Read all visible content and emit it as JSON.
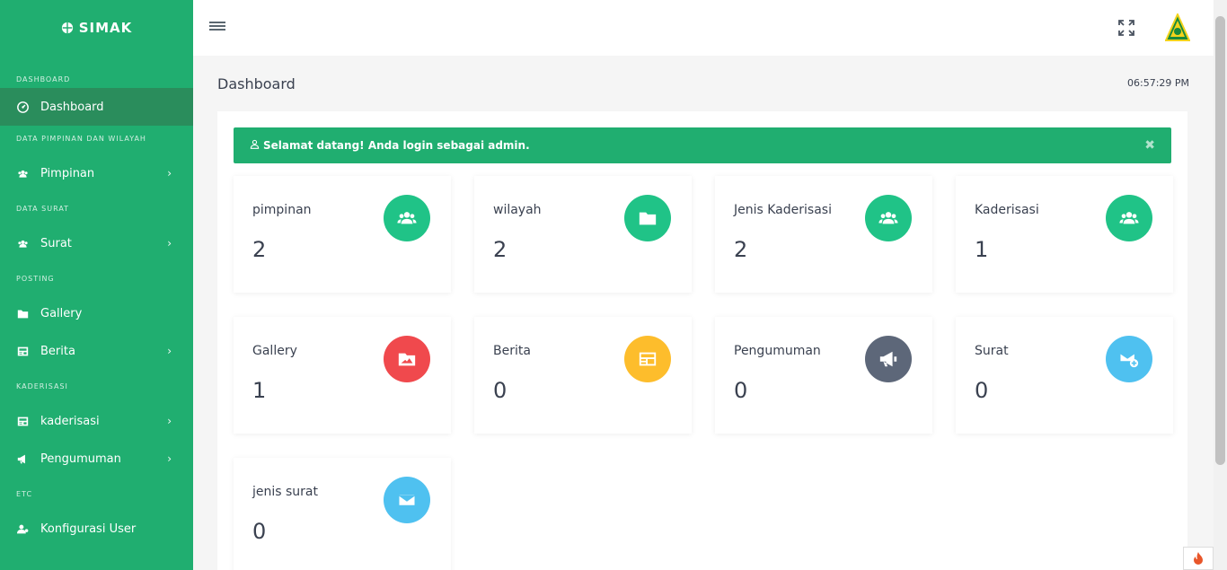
{
  "app": {
    "name": "SIMAK"
  },
  "sidebar": {
    "sections": [
      {
        "title": "DASHBOARD"
      },
      {
        "title": "DATA PIMPINAN DAN WILAYAH"
      },
      {
        "title": "DATA SURAT"
      },
      {
        "title": "POSTING"
      },
      {
        "title": "KADERISASI"
      },
      {
        "title": "ETC"
      }
    ],
    "items": [
      {
        "label": "Dashboard",
        "icon": "dashboard-icon"
      },
      {
        "label": "Pimpinan",
        "icon": "users-icon",
        "chevron": "›"
      },
      {
        "label": "Surat",
        "icon": "users-icon",
        "chevron": "›"
      },
      {
        "label": "Gallery",
        "icon": "folder-icon"
      },
      {
        "label": "Berita",
        "icon": "newspaper-icon",
        "chevron": "›"
      },
      {
        "label": "kaderisasi",
        "icon": "newspaper-icon",
        "chevron": "›"
      },
      {
        "label": "Pengumuman",
        "icon": "bullhorn-icon",
        "chevron": "›"
      },
      {
        "label": "Konfigurasi User",
        "icon": "users-cog-icon"
      }
    ]
  },
  "header": {
    "page_title": "Dashboard",
    "time": "06:57:29 PM"
  },
  "alert": {
    "message": "Selamat datang! Anda login sebagai admin.",
    "close": "✖"
  },
  "stats": [
    {
      "title": "pimpinan",
      "value": "2",
      "icon": "users-icon",
      "color": "#20c387"
    },
    {
      "title": "wilayah",
      "value": "2",
      "icon": "folder-icon",
      "color": "#20c387"
    },
    {
      "title": "Jenis Kaderisasi",
      "value": "2",
      "icon": "users-icon",
      "color": "#20c387"
    },
    {
      "title": "Kaderisasi",
      "value": "1",
      "icon": "users-icon",
      "color": "#20c387"
    },
    {
      "title": "Gallery",
      "value": "1",
      "icon": "image-folder-icon",
      "color": "#f0494d"
    },
    {
      "title": "Berita",
      "value": "0",
      "icon": "newspaper-icon",
      "color": "#fdbd2c"
    },
    {
      "title": "Pengumuman",
      "value": "0",
      "icon": "bullhorn-icon",
      "color": "#5d6779"
    },
    {
      "title": "Surat",
      "value": "0",
      "icon": "mail-plus-icon",
      "color": "#4fc1f0"
    },
    {
      "title": "jenis surat",
      "value": "0",
      "icon": "mail-icon",
      "color": "#4fc1f0"
    }
  ],
  "colors": {
    "primary": "#20ae70",
    "active": "#2a8d5c"
  }
}
